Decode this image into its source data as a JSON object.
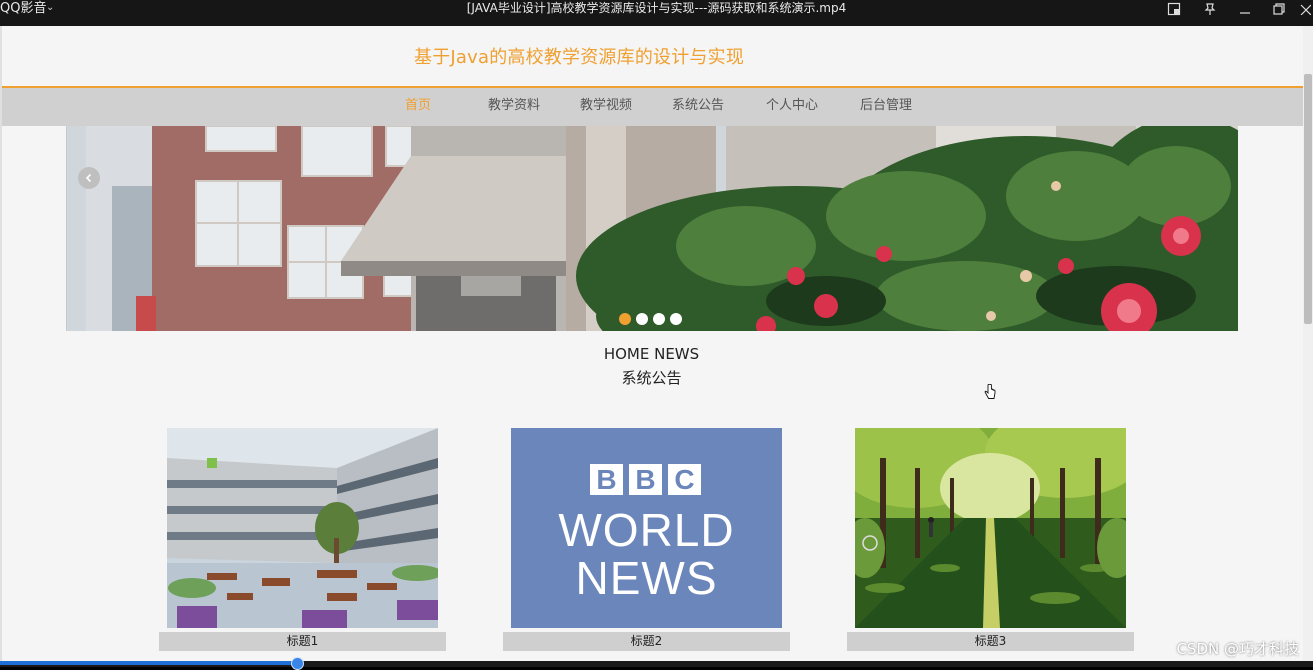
{
  "player": {
    "name": "QQ影音",
    "video_title": "[JAVA毕业设计]高校教学资源库设计与实现---源码获取和系统演示.mp4",
    "progress": 0.226
  },
  "site": {
    "title": "基于Java的高校教学资源库的设计与实现"
  },
  "nav": {
    "items": [
      {
        "label": "首页",
        "active": true
      },
      {
        "label": "教学资料",
        "active": false
      },
      {
        "label": "教学视频",
        "active": false
      },
      {
        "label": "系统公告",
        "active": false
      },
      {
        "label": "个人中心",
        "active": false
      },
      {
        "label": "后台管理",
        "active": false
      }
    ]
  },
  "carousel": {
    "slide_count": 4,
    "active_index": 0
  },
  "news": {
    "heading_en": "HOME NEWS",
    "heading_cn": "系统公告",
    "cards": [
      {
        "caption": "标题1"
      },
      {
        "caption": "标题2",
        "logo_lines": [
          "BBC",
          "WORLD",
          "NEWS"
        ]
      },
      {
        "caption": "标题3"
      }
    ]
  },
  "watermark": "CSDN @巧才科技",
  "colors": {
    "accent": "#f0a031",
    "nav_bg": "#d0d0d0",
    "bbc_bg": "#6b86ba"
  }
}
